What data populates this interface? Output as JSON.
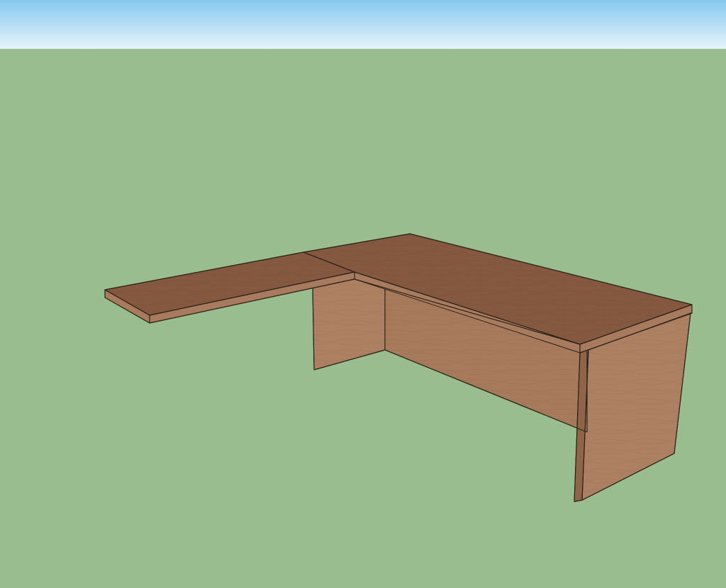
{
  "viewport": {
    "sky_gradient_top": "#86c8ef",
    "sky_gradient_bottom": "#e6f3fb",
    "ground_color": "#9abd8f",
    "edge_color": "#2b2118"
  },
  "model": {
    "object": "l-shaped-desk",
    "materials": {
      "top_surface": "#845940",
      "top_surface_dark": "#7a5239",
      "panel_face": "#a77a5c",
      "panel_face_light": "#ad8062",
      "panel_shadow": "#8f6448",
      "edge_band": "#a87b5e"
    }
  }
}
